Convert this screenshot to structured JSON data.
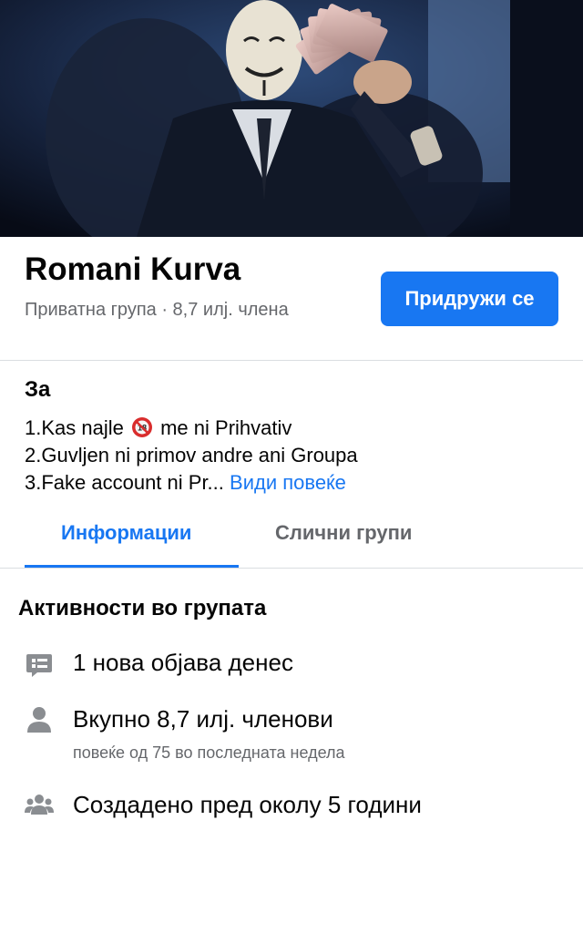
{
  "cover": {
    "description": ""
  },
  "group": {
    "name": "Romani Kurva",
    "meta": "Приватна група · 8,7 илј. члена",
    "join_label": "Придружи се"
  },
  "about": {
    "heading": "За",
    "line1_prefix": "1.Kas najle",
    "line1_emoji": "18",
    "line1_suffix": "me ni Prihvativ",
    "line2": "2.Guvljen ni primov andre ani Groupa",
    "line3": "3.Fake account ni Pr...",
    "see_more": "Види повеќе"
  },
  "tabs": {
    "info": "Информации",
    "similar": "Слични групи"
  },
  "activity": {
    "heading": "Активности во групата",
    "posts": "1 нова објава денес",
    "members": "Вкупно 8,7 илј. членови",
    "members_sub": "повеќе од 75 во последната недела",
    "created": "Создадено пред околу 5 години"
  },
  "icons": {
    "posts": "post-bubble-icon",
    "members": "person-icon",
    "created": "group-people-icon"
  },
  "colors": {
    "accent": "#1877f2",
    "secondary_text": "#65676b",
    "icon_gray": "#8a8d91"
  }
}
